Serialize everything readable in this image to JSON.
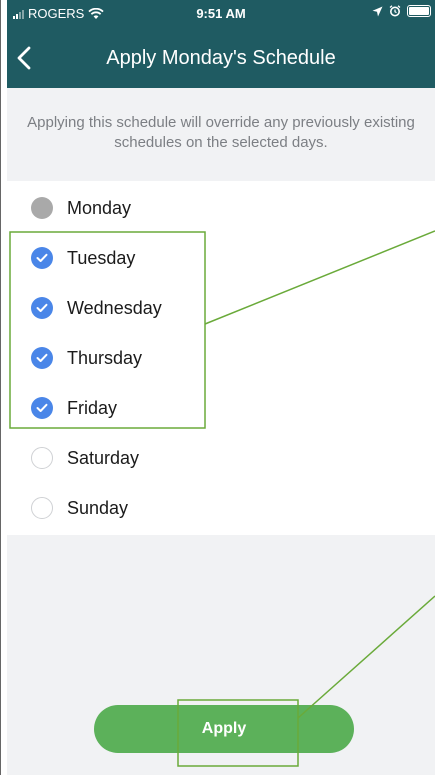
{
  "status_bar": {
    "carrier": "ROGERS",
    "time": "9:51 AM"
  },
  "nav": {
    "title": "Apply Monday's Schedule"
  },
  "notice": "Applying this schedule will override any previously existing schedules on the selected days.",
  "days": [
    {
      "label": "Monday",
      "state": "disabled"
    },
    {
      "label": "Tuesday",
      "state": "checked"
    },
    {
      "label": "Wednesday",
      "state": "checked"
    },
    {
      "label": "Thursday",
      "state": "checked"
    },
    {
      "label": "Friday",
      "state": "checked"
    },
    {
      "label": "Saturday",
      "state": "unchecked"
    },
    {
      "label": "Sunday",
      "state": "unchecked"
    }
  ],
  "apply_label": "Apply",
  "colors": {
    "header": "#1f5b62",
    "checked": "#4a86e8",
    "disabled": "#a9a9a9",
    "apply_button": "#5cb15a",
    "annotation": "#6aaa3a"
  },
  "icons": {
    "back": "chevron-left-icon",
    "wifi": "wifi-icon",
    "location": "location-arrow-icon",
    "alarm": "alarm-icon",
    "battery": "battery-icon",
    "check": "checkmark-icon"
  }
}
